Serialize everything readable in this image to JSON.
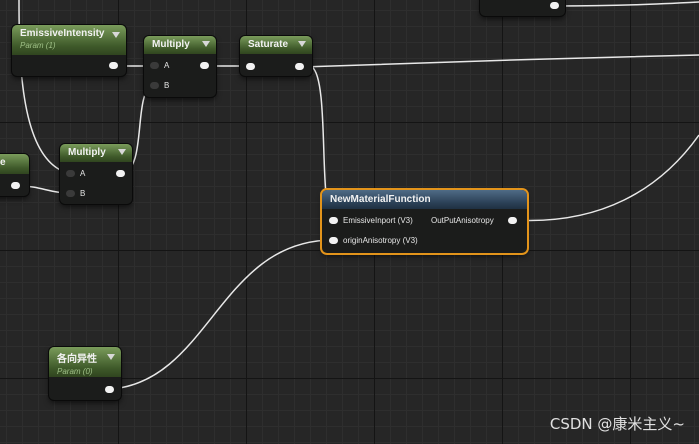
{
  "nodes": {
    "emissive_intensity": {
      "title": "EmissiveIntensity",
      "subtitle": "Param (1)"
    },
    "multiply_top": {
      "title": "Multiply",
      "pin_a": "A",
      "pin_b": "B"
    },
    "saturate": {
      "title": "Saturate"
    },
    "multiply_left": {
      "title": "Multiply",
      "pin_a": "A",
      "pin_b": "B"
    },
    "partial_left": {
      "title": "e"
    },
    "new_material_function": {
      "title": "NewMaterialFunction",
      "input_1": "EmissiveInport (V3)",
      "input_2": "originAnisotropy (V3)",
      "output_1": "OutPutAnisotropy"
    },
    "anisotropy_param": {
      "title": "各向异性",
      "subtitle": "Param (0)"
    }
  },
  "watermark": "CSDN @康米主义~"
}
